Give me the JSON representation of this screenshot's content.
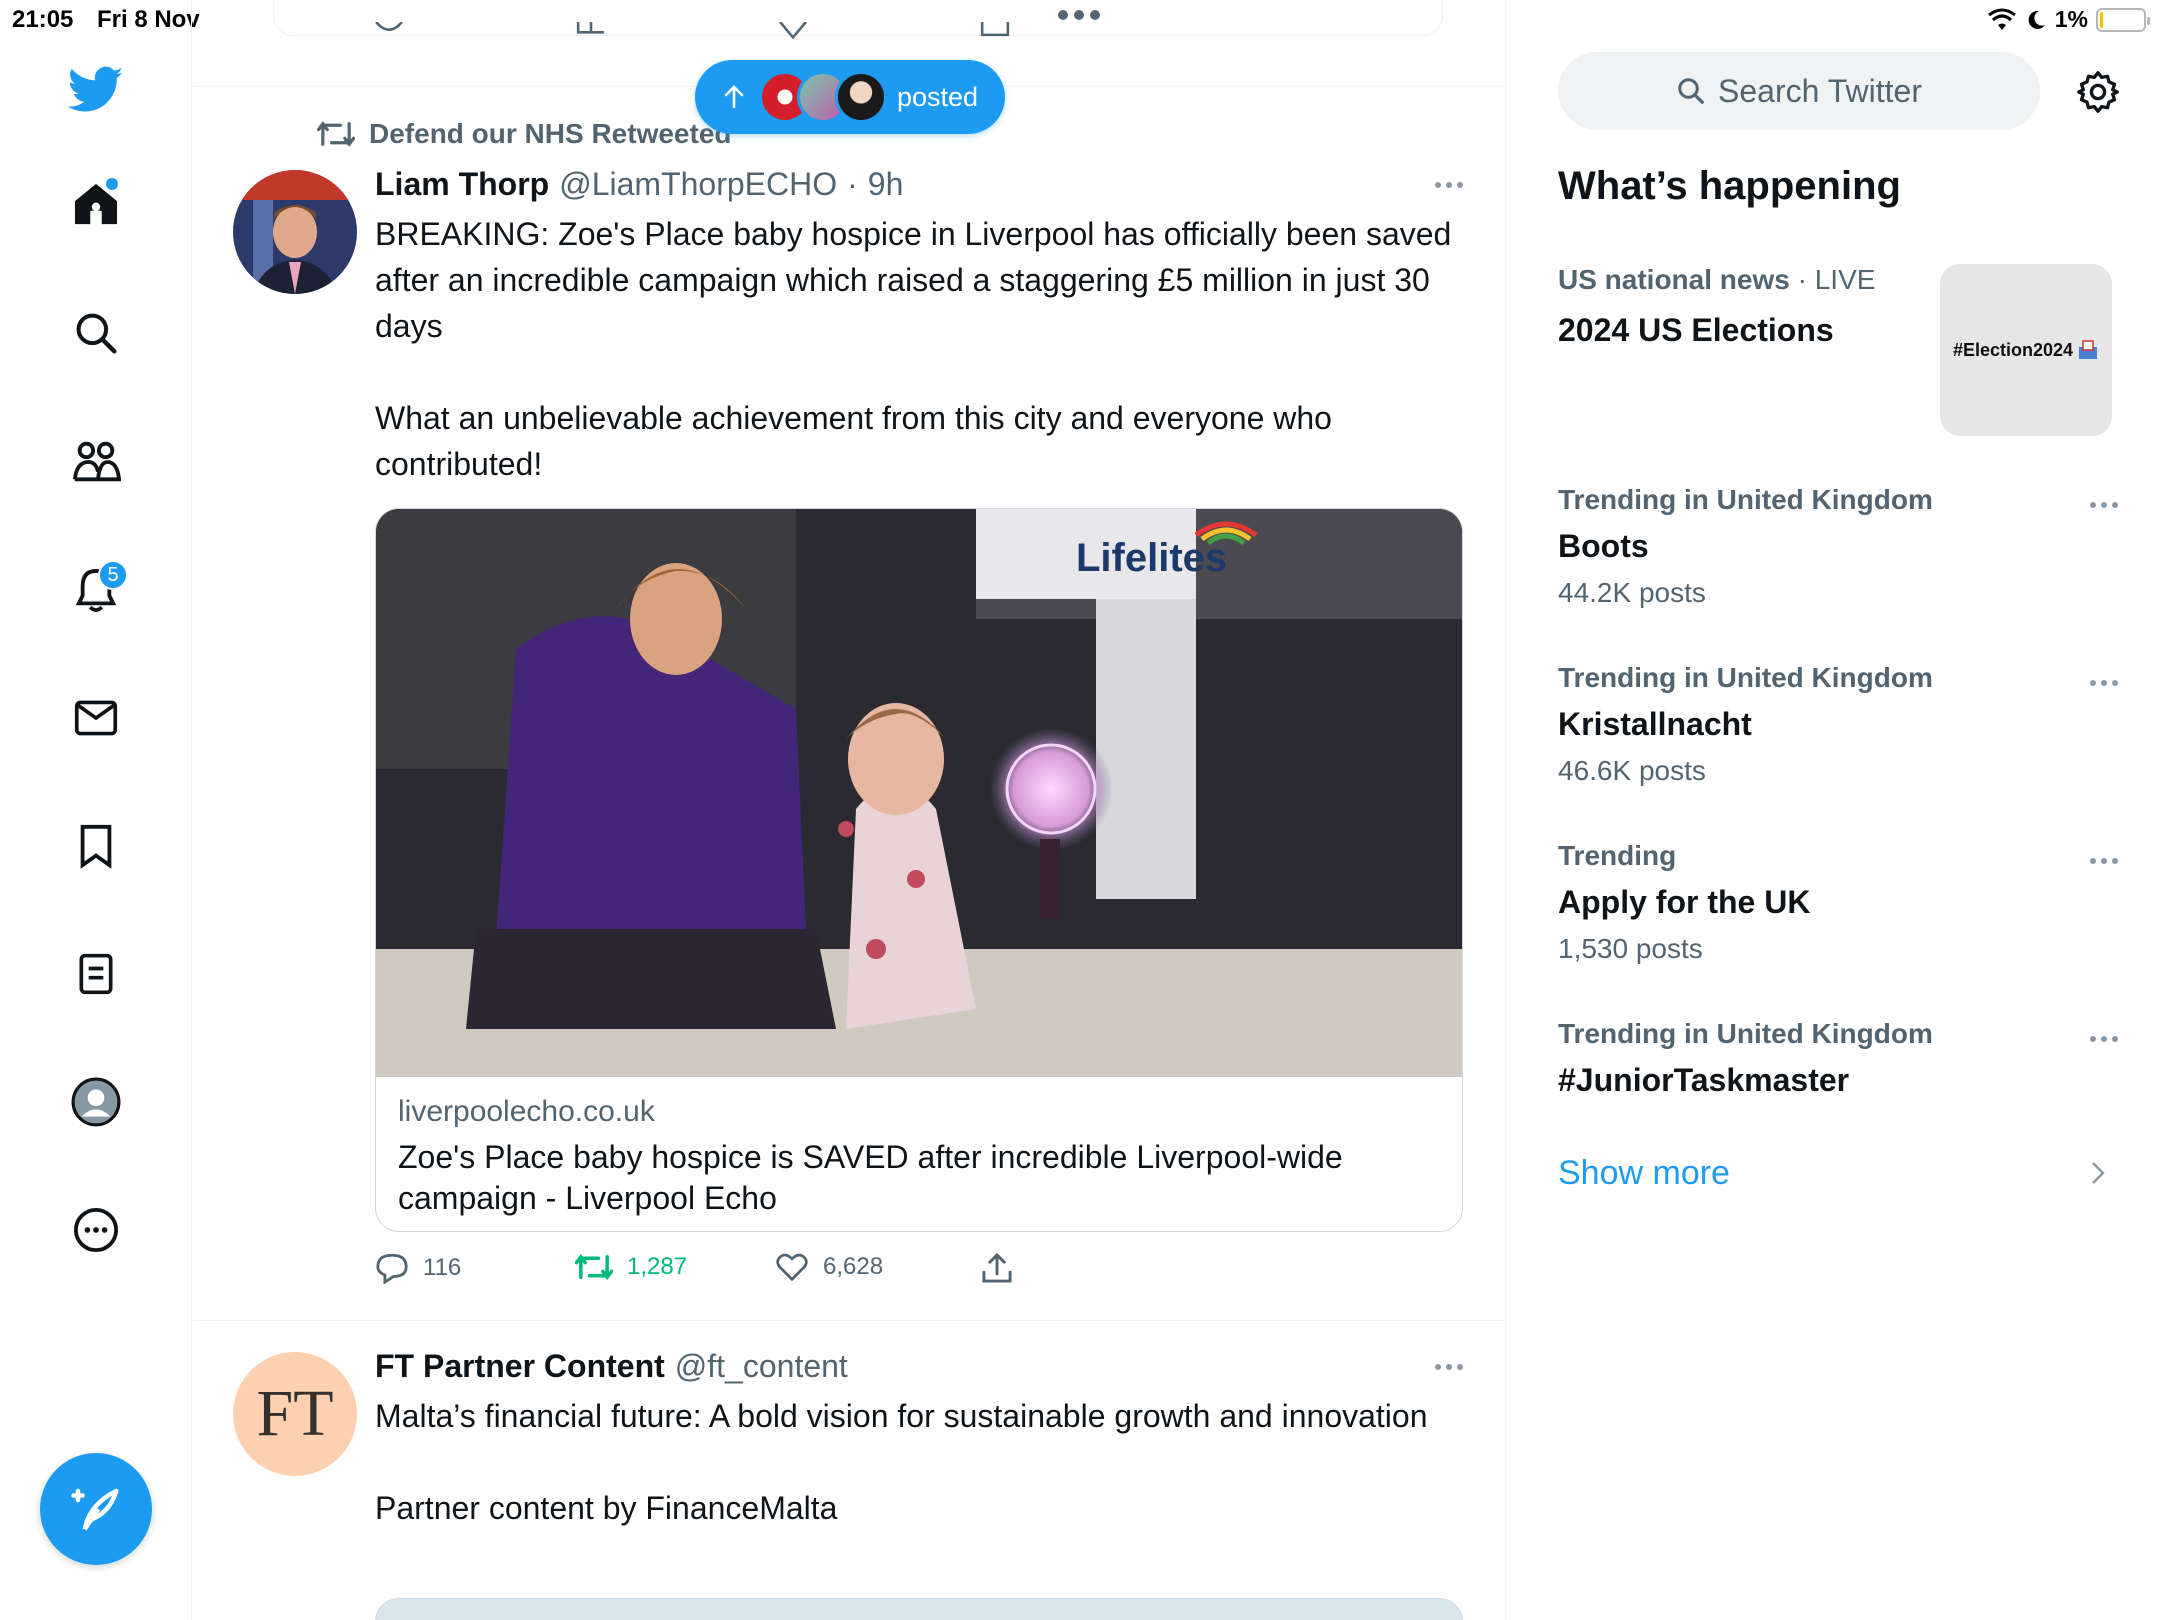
{
  "status_bar": {
    "time": "21:05",
    "date": "Fri 8 Nov",
    "battery": "1%"
  },
  "sidebar": {
    "items": [
      {
        "icon": "home-icon"
      },
      {
        "icon": "search-icon"
      },
      {
        "icon": "communities-icon"
      },
      {
        "icon": "notifications-icon",
        "badge": "5"
      },
      {
        "icon": "messages-icon"
      },
      {
        "icon": "bookmarks-icon"
      },
      {
        "icon": "lists-icon"
      },
      {
        "icon": "profile-icon"
      },
      {
        "icon": "more-icon"
      }
    ],
    "compose_icon": "compose-icon"
  },
  "new_posts_pill": {
    "label": "posted"
  },
  "tweet1": {
    "retweeted_by": "Defend our NHS Retweeted",
    "name": "Liam Thorp",
    "handle": "@LiamThorpECHO",
    "dot": "·",
    "time": "9h",
    "text": "BREAKING: Zoe's Place baby hospice in Liverpool has officially been saved after an incredible campaign which raised a staggering £5 million in just 30 days\n\nWhat an unbelievable achievement from this city and everyone who contributed!",
    "card": {
      "image_sign": "Lifelites",
      "domain": "liverpoolecho.co.uk",
      "title": "Zoe's Place baby hospice is SAVED after incredible Liverpool-wide campaign - Liverpool Echo"
    },
    "replies": "116",
    "retweets": "1,287",
    "likes": "6,628"
  },
  "tweet2": {
    "avatar_text": "FT",
    "name": "FT Partner Content",
    "handle": "@ft_content",
    "text": "Malta’s financial future: A bold vision for sustainable growth and innovation\n\nPartner content by FinanceMalta"
  },
  "right": {
    "search_placeholder": "Search Twitter",
    "section_title": "What’s happening",
    "featured": {
      "category": "US national news",
      "dot": " · ",
      "live": "LIVE",
      "title": "2024 US Elections",
      "image_label": "#Election2024"
    },
    "trends": [
      {
        "meta": "Trending in United Kingdom",
        "name": "Boots",
        "count": "44.2K posts"
      },
      {
        "meta": "Trending in United Kingdom",
        "name": "Kristallnacht",
        "count": "46.6K posts"
      },
      {
        "meta": "Trending",
        "name": "Apply for the UK",
        "count": "1,530 posts"
      },
      {
        "meta": "Trending in United Kingdom",
        "name": "#JuniorTaskmaster",
        "count": ""
      }
    ],
    "show_more": "Show more"
  },
  "colors": {
    "accent": "#1d9bf0",
    "retweet_green": "#00ba7c",
    "secondary_text": "#536471"
  }
}
